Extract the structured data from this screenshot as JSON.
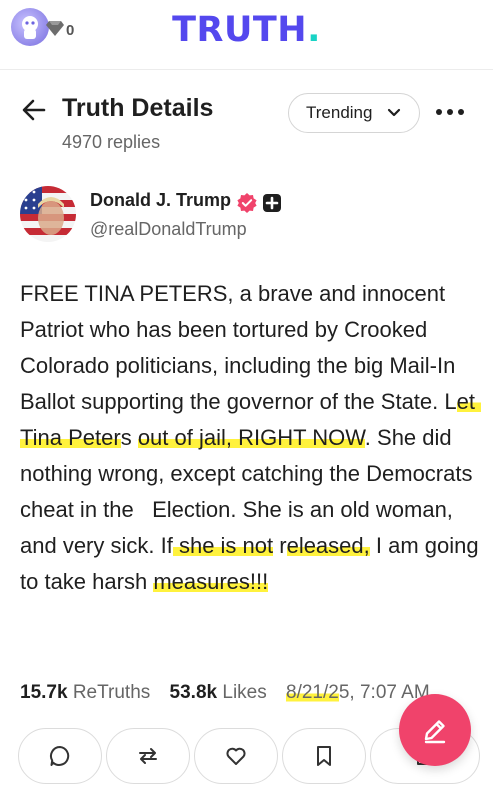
{
  "topbar": {
    "logo_main": "TRUTH",
    "logo_dot": ".",
    "gem_count": "0"
  },
  "header": {
    "title": "Truth Details",
    "replies": "4970 replies",
    "sort_label": "Trending"
  },
  "author": {
    "name": "Donald J. Trump",
    "handle": "@realDonaldTrump"
  },
  "post": {
    "segments": [
      {
        "text": "FREE TINA PETERS, a brave and innocent Patriot who has been tortured by Crooked Colorado politicians, including the big Mail-In Ballot supporting the governor of the State. L",
        "highlight": false
      },
      {
        "text": "et Tina Peter",
        "highlight": true
      },
      {
        "text": "s ",
        "highlight": false
      },
      {
        "text": "out of jail, RIGHT NOW",
        "highlight": true
      },
      {
        "text": ". She did nothing wrong, except catching the Democrats cheat in the   Election. She is an old woman, and very sick. If",
        "highlight": false
      },
      {
        "text": " she is not",
        "highlight": true
      },
      {
        "text": " r",
        "highlight": false
      },
      {
        "text": "eleased,",
        "highlight": true
      },
      {
        "text": " I am going to take harsh ",
        "highlight": false
      },
      {
        "text": "measures!!!",
        "highlight": true
      }
    ]
  },
  "stats": {
    "retruths_count": "15.7k",
    "retruths_label": "ReTruths",
    "likes_count": "53.8k",
    "likes_label": "Likes",
    "date_highlight": "8/21/2",
    "date_rest": "5, 7:07 AM"
  },
  "actions": [
    "reply-icon",
    "retruth-icon",
    "like-icon",
    "bookmark-icon",
    "share-icon"
  ],
  "colors": {
    "brand": "#5448ee",
    "accent_dot": "#19d3c5",
    "fab": "#f0436b",
    "verified": "#f0436b",
    "highlight": "#fff028"
  }
}
